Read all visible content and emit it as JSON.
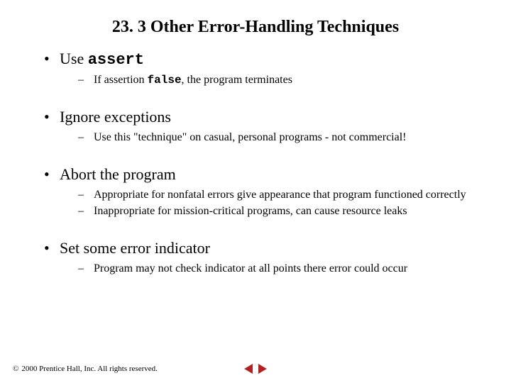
{
  "title": "23. 3  Other Error-Handling Techniques",
  "bullets": [
    {
      "label_pre": "Use ",
      "label_code": "assert",
      "label_post": "",
      "subs": [
        {
          "pre": "If assertion ",
          "code": "false",
          "post": ", the program terminates"
        }
      ]
    },
    {
      "label_pre": "Ignore exceptions",
      "label_code": "",
      "label_post": "",
      "subs": [
        {
          "pre": "Use this \"technique\" on casual, personal programs - not commercial!",
          "code": "",
          "post": ""
        }
      ]
    },
    {
      "label_pre": "Abort the program",
      "label_code": "",
      "label_post": "",
      "subs": [
        {
          "pre": "Appropriate for nonfatal errors give appearance that program functioned correctly",
          "code": "",
          "post": ""
        },
        {
          "pre": "Inappropriate for mission-critical programs, can cause resource leaks",
          "code": "",
          "post": ""
        }
      ]
    },
    {
      "label_pre": "Set some error indicator",
      "label_code": "",
      "label_post": "",
      "subs": [
        {
          "pre": "Program may not check indicator at all points there error could occur",
          "code": "",
          "post": ""
        }
      ]
    }
  ],
  "footer": {
    "copyright_symbol": "©",
    "copyright_text": "2000 Prentice Hall, Inc. All rights reserved."
  }
}
